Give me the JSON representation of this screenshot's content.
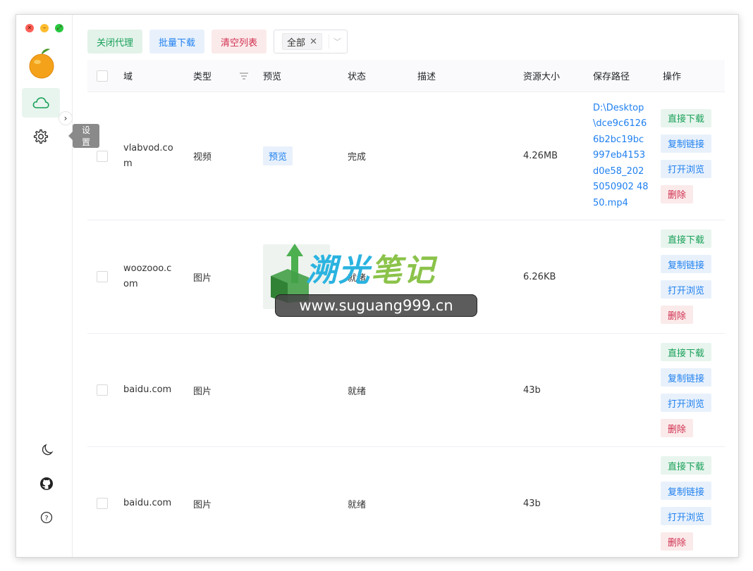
{
  "toolbar": {
    "proxy_label": "关闭代理",
    "batch_download_label": "批量下载",
    "clear_list_label": "清空列表",
    "filter_value": "全部"
  },
  "sidebar": {
    "tooltip": "设置",
    "icons": [
      "cloud-icon",
      "gear-icon",
      "moon-icon",
      "github-icon",
      "help-icon"
    ]
  },
  "table": {
    "headers": {
      "domain": "域",
      "type": "类型",
      "preview": "预览",
      "status": "状态",
      "desc": "描述",
      "size": "资源大小",
      "path": "保存路径",
      "ops": "操作"
    },
    "rows": [
      {
        "domain": "vlabvod.com",
        "type": "视频",
        "preview": "预览",
        "status": "完成",
        "desc": "",
        "size": "4.26MB",
        "path": "D:\\Desktop\\dce9c61266b2bc19bc997eb4153d0e58_2025050902 4850.mp4"
      },
      {
        "domain": "woozooo.com",
        "type": "图片",
        "preview": "",
        "status": "就绪",
        "desc": "",
        "size": "6.26KB",
        "path": ""
      },
      {
        "domain": "baidu.com",
        "type": "图片",
        "preview": "",
        "status": "就绪",
        "desc": "",
        "size": "43b",
        "path": ""
      },
      {
        "domain": "baidu.com",
        "type": "图片",
        "preview": "",
        "status": "就绪",
        "desc": "",
        "size": "43b",
        "path": ""
      }
    ],
    "ops": {
      "direct_download": "直接下载",
      "copy_link": "复制链接",
      "open_browse": "打开浏览",
      "delete": "删除"
    }
  },
  "watermark": {
    "title_a": "溯光",
    "title_b": "笔记",
    "url": "www.suguang999.cn"
  },
  "colors": {
    "green": "#18a058",
    "blue": "#2080f0",
    "red": "#d03050"
  }
}
